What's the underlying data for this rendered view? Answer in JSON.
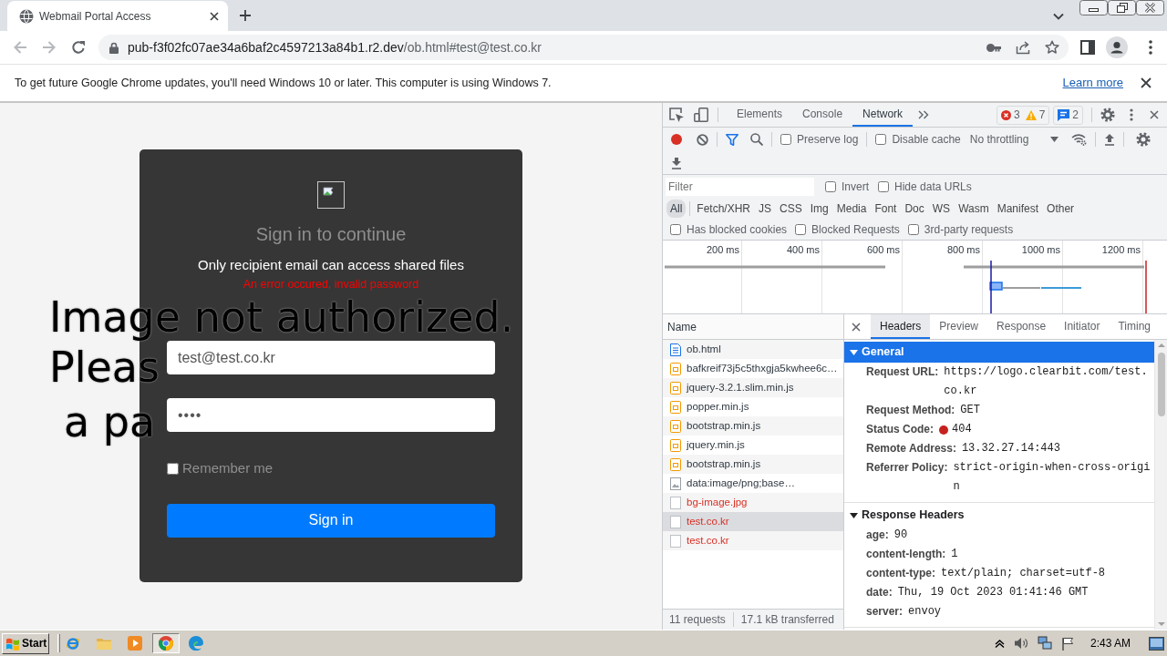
{
  "browser": {
    "tabs": [
      {
        "title": "Webmail Portal Access",
        "selected": true
      }
    ],
    "address": {
      "host": "pub-f3f02fc07ae34a6baf2c4597213a84b1.r2.dev",
      "path": "/ob.html#test@test.co.kr"
    },
    "infobar": {
      "message": "To get future Google Chrome updates, you'll need Windows 10 or later. This computer is using Windows 7.",
      "link": "Learn more"
    }
  },
  "page": {
    "background_text": [
      "Image not authorized.",
      "Pleas",
      "a pa"
    ],
    "card": {
      "title": "Sign in to continue",
      "subtitle": "Only recipient email can access shared files",
      "error": "An error occured, invalid password",
      "email": "test@test.co.kr",
      "password": "••••",
      "remember": {
        "label": "Remember me",
        "checked": false
      },
      "button": "Sign in"
    }
  },
  "devtools": {
    "tabs": [
      {
        "label": "Elements",
        "selected": false
      },
      {
        "label": "Console",
        "selected": false
      },
      {
        "label": "Network",
        "selected": true
      }
    ],
    "issues": {
      "errors": "3",
      "warnings": "7",
      "messages": "2"
    },
    "toolbar": {
      "recording": true,
      "options": [
        {
          "label": "Preserve log",
          "checked": false
        },
        {
          "label": "Disable cache",
          "checked": false
        }
      ],
      "throttling": "No throttling"
    },
    "filter": {
      "placeholder": "Filter",
      "options": [
        {
          "label": "Invert",
          "checked": false
        },
        {
          "label": "Hide data URLs",
          "checked": false
        }
      ]
    },
    "types": [
      {
        "label": "All",
        "selected": true
      },
      {
        "label": "Fetch/XHR",
        "selected": false
      },
      {
        "label": "JS",
        "selected": false
      },
      {
        "label": "CSS",
        "selected": false
      },
      {
        "label": "Img",
        "selected": false
      },
      {
        "label": "Media",
        "selected": false
      },
      {
        "label": "Font",
        "selected": false
      },
      {
        "label": "Doc",
        "selected": false
      },
      {
        "label": "WS",
        "selected": false
      },
      {
        "label": "Wasm",
        "selected": false
      },
      {
        "label": "Manifest",
        "selected": false
      },
      {
        "label": "Other",
        "selected": false
      }
    ],
    "request_filters": [
      {
        "label": "Has blocked cookies",
        "checked": false
      },
      {
        "label": "Blocked Requests",
        "checked": false
      },
      {
        "label": "3rd-party requests",
        "checked": false
      }
    ],
    "overview": {
      "ticks": [
        "200 ms",
        "400 ms",
        "600 ms",
        "800 ms",
        "1000 ms",
        "1200 ms"
      ]
    },
    "requests": {
      "column": "Name",
      "rows": [
        {
          "name": "ob.html",
          "kind": "document",
          "failed": false,
          "selected": false
        },
        {
          "name": "bafkreif73j5c5thxgja5kwhee6c…",
          "kind": "script",
          "failed": false,
          "selected": false
        },
        {
          "name": "jquery-3.2.1.slim.min.js",
          "kind": "script",
          "failed": false,
          "selected": false
        },
        {
          "name": "popper.min.js",
          "kind": "script",
          "failed": false,
          "selected": false
        },
        {
          "name": "bootstrap.min.js",
          "kind": "script",
          "failed": false,
          "selected": false
        },
        {
          "name": "jquery.min.js",
          "kind": "script",
          "failed": false,
          "selected": false
        },
        {
          "name": "bootstrap.min.js",
          "kind": "script",
          "failed": false,
          "selected": false
        },
        {
          "name": "data:image/png;base…",
          "kind": "image",
          "failed": false,
          "selected": false
        },
        {
          "name": "bg-image.jpg",
          "kind": "other",
          "failed": true,
          "selected": false
        },
        {
          "name": "test.co.kr",
          "kind": "other",
          "failed": true,
          "selected": true
        },
        {
          "name": "test.co.kr",
          "kind": "other",
          "failed": true,
          "selected": false
        }
      ],
      "summary": [
        "11 requests",
        "17.1 kB transferred"
      ]
    },
    "details": {
      "tabs": [
        {
          "label": "Headers",
          "selected": true
        },
        {
          "label": "Preview",
          "selected": false
        },
        {
          "label": "Response",
          "selected": false
        },
        {
          "label": "Initiator",
          "selected": false
        },
        {
          "label": "Timing",
          "selected": false
        }
      ],
      "sections": [
        {
          "title": "General",
          "expanded": true,
          "selected": true,
          "rows": [
            {
              "kind": "plain",
              "label": "Request URL:",
              "value": "https://logo.clearbit.com/test.co.kr"
            },
            {
              "kind": "plain",
              "label": "Request Method:",
              "value": "GET"
            },
            {
              "kind": "status",
              "label": "Status Code:",
              "value": "404"
            },
            {
              "kind": "plain",
              "label": "Remote Address:",
              "value": "13.32.27.14:443"
            },
            {
              "kind": "plain",
              "label": "Referrer Policy:",
              "value": "strict-origin-when-cross-origin"
            }
          ]
        },
        {
          "title": "Response Headers",
          "expanded": true,
          "selected": false,
          "rows": [
            {
              "kind": "plain",
              "label": "age:",
              "value": "90"
            },
            {
              "kind": "plain",
              "label": "content-length:",
              "value": "1"
            },
            {
              "kind": "plain",
              "label": "content-type:",
              "value": "text/plain; charset=utf-8"
            },
            {
              "kind": "plain",
              "label": "date:",
              "value": "Thu, 19 Oct 2023 01:41:46 GMT"
            },
            {
              "kind": "plain",
              "label": "server:",
              "value": "envoy"
            }
          ]
        }
      ]
    }
  },
  "taskbar": {
    "start": "Start",
    "clock": "2:43 AM"
  }
}
